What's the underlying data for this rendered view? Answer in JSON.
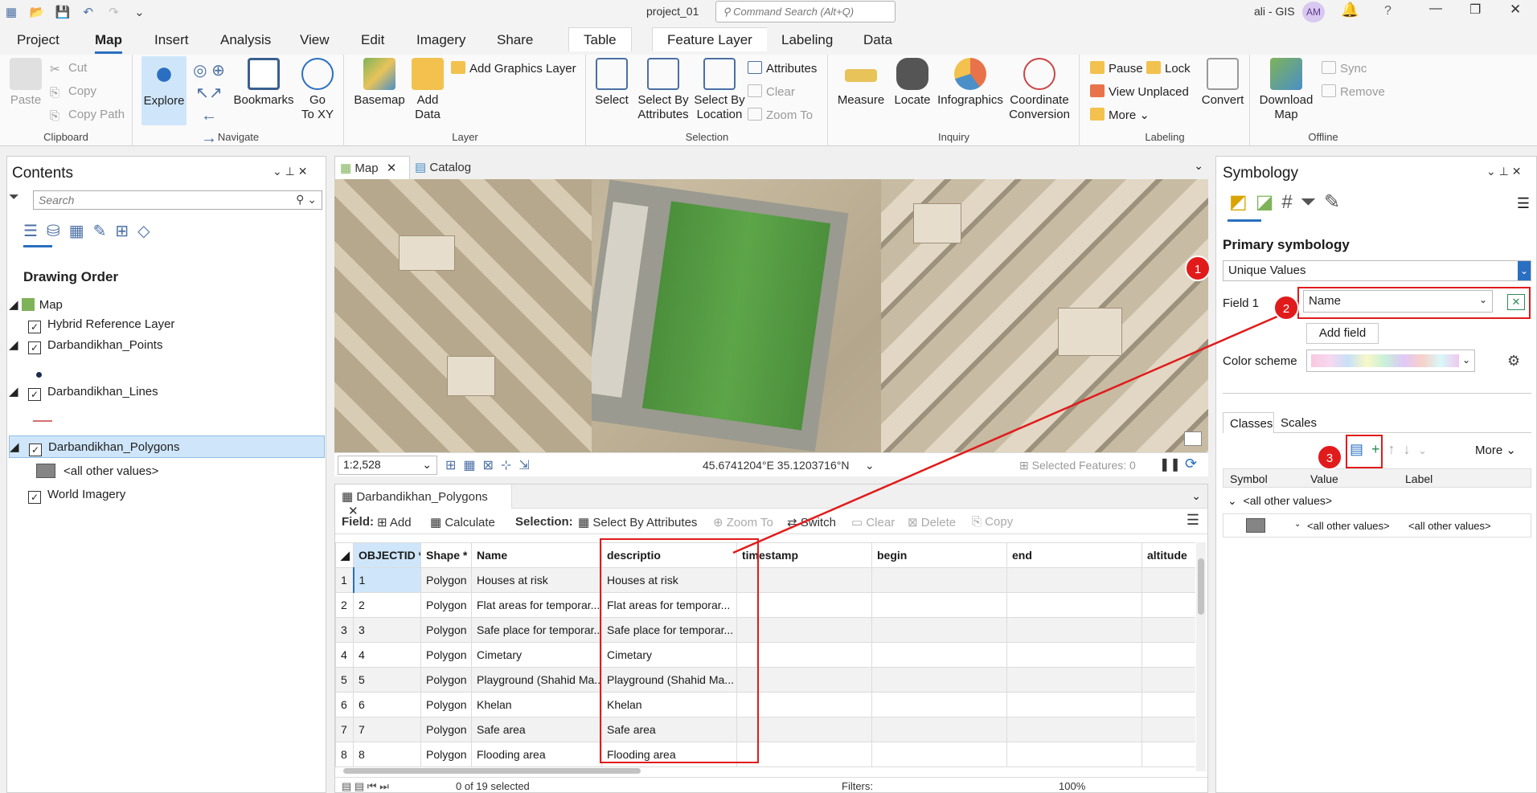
{
  "app": {
    "title": "project_01",
    "command_search": "Command Search (Alt+Q)",
    "user": "ali - GIS",
    "user_initials": "AM"
  },
  "ribbon_tabs": [
    "Project",
    "Map",
    "Insert",
    "Analysis",
    "View",
    "Edit",
    "Imagery",
    "Share",
    "Table",
    "Feature Layer",
    "Labeling",
    "Data"
  ],
  "clipboard": {
    "paste": "Paste",
    "cut": "Cut",
    "copy": "Copy",
    "copy_path": "Copy Path",
    "label": "Clipboard"
  },
  "navigate": {
    "explore": "Explore",
    "bookmarks": "Bookmarks",
    "goto": "Go\nTo XY",
    "label": "Navigate"
  },
  "layer": {
    "basemap": "Basemap",
    "add_data": "Add\nData",
    "add_graphics": "Add Graphics Layer",
    "label": "Layer"
  },
  "selection": {
    "select": "Select",
    "by_attr": "Select By\nAttributes",
    "by_loc": "Select By\nLocation",
    "attributes": "Attributes",
    "clear": "Clear",
    "zoom_to": "Zoom To",
    "label": "Selection"
  },
  "inquiry": {
    "measure": "Measure",
    "locate": "Locate",
    "infographics": "Infographics",
    "coord": "Coordinate\nConversion",
    "label": "Inquiry"
  },
  "labeling": {
    "pause": "Pause",
    "lock": "Lock",
    "view_unplaced": "View Unplaced",
    "more": "More",
    "convert": "Convert",
    "label": "Labeling"
  },
  "offline": {
    "download": "Download\nMap",
    "sync": "Sync",
    "remove": "Remove",
    "label": "Offline"
  },
  "contents": {
    "title": "Contents",
    "search_placeholder": "Search",
    "drawing_order": "Drawing Order",
    "map": "Map",
    "layers": [
      "Hybrid Reference Layer",
      "Darbandikhan_Points",
      "Darbandikhan_Lines",
      "Darbandikhan_Polygons",
      "World Imagery"
    ],
    "other_values": "<all other values>"
  },
  "view_tabs": {
    "map": "Map",
    "catalog": "Catalog"
  },
  "map_status": {
    "scale": "1:2,528",
    "coords": "45.6741204°E 35.1203716°N",
    "selected": "Selected Features: 0"
  },
  "table": {
    "tab": "Darbandikhan_Polygons",
    "field_label": "Field:",
    "add": "Add",
    "calculate": "Calculate",
    "selection_label": "Selection:",
    "select_by_attr": "Select By Attributes",
    "zoom_to": "Zoom To",
    "switch": "Switch",
    "clear": "Clear",
    "delete": "Delete",
    "copy": "Copy",
    "columns": [
      "OBJECTID *",
      "Shape *",
      "Name",
      "descriptio",
      "timestamp",
      "begin",
      "end",
      "altitude"
    ],
    "rows": [
      [
        "1",
        "1",
        "Polygon",
        "Houses at risk",
        "Houses at risk"
      ],
      [
        "2",
        "2",
        "Polygon",
        "Flat areas for temporar...",
        "Flat areas for temporar..."
      ],
      [
        "3",
        "3",
        "Polygon",
        "Safe place for temporar...",
        "Safe place for temporar..."
      ],
      [
        "4",
        "4",
        "Polygon",
        "Cimetary",
        "Cimetary"
      ],
      [
        "5",
        "5",
        "Polygon",
        "Playground (Shahid Ma...",
        "Playground (Shahid Ma..."
      ],
      [
        "6",
        "6",
        "Polygon",
        "Khelan",
        "Khelan"
      ],
      [
        "7",
        "7",
        "Polygon",
        "Safe area",
        "Safe area"
      ],
      [
        "8",
        "8",
        "Polygon",
        "Flooding area",
        "Flooding area"
      ]
    ],
    "footer": "0 of 19 selected",
    "filters": "Filters:",
    "zoom": "100%"
  },
  "symbology": {
    "title": "Symbology",
    "primary": "Primary symbology",
    "method": "Unique Values",
    "field1_label": "Field 1",
    "field1": "Name",
    "add_field": "Add field",
    "color_scheme": "Color scheme",
    "tab_classes": "Classes",
    "tab_scales": "Scales",
    "more": "More",
    "col_symbol": "Symbol",
    "col_value": "Value",
    "col_label": "Label",
    "group": "<all other values>",
    "val": "<all other values>",
    "lbl": "<all other values>"
  },
  "annotations": [
    "1",
    "2",
    "3"
  ],
  "colors": {
    "accent": "#2a6fc1",
    "red": "#e11b1b",
    "active_tab": "#cfe6fa"
  }
}
